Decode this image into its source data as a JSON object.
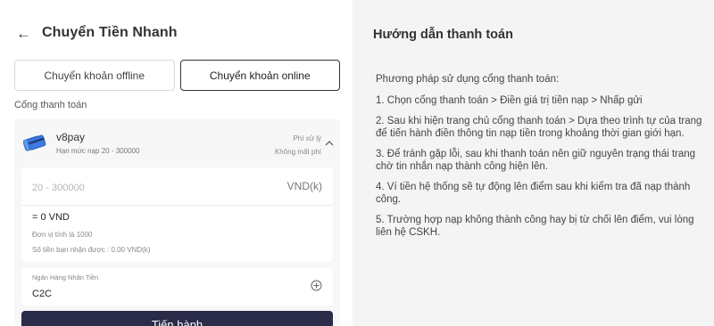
{
  "header": {
    "title": "Chuyển Tiền Nhanh",
    "back_icon": "arrow-left-icon"
  },
  "tabs": [
    {
      "label": "Chuyển khoản offline",
      "active": false
    },
    {
      "label": "Chuyển khoản online",
      "active": true
    }
  ],
  "payment_gateway": {
    "section_label": "Cổng thanh toán",
    "name": "v8pay",
    "limit": "Hạn mức nạp 20 - 300000",
    "fee_label": "Phí xử lý",
    "fee_value": "Không mất phí",
    "card_icon": "credit-card-icon",
    "amount": {
      "placeholder": "20 - 300000",
      "value": "",
      "unit": "VND(k)",
      "converted": "= 0 VND",
      "unit_note": "Đơn vị tính là 1000",
      "receive_note": "Số tiền bạn nhận được : 0.00 VND(k)"
    },
    "bank": {
      "label": "Ngân Hàng Nhận Tiền",
      "value": "C2C"
    },
    "submit_label": "Tiến hành"
  },
  "guide": {
    "title": "Hướng dẫn thanh toán",
    "intro": "Phương pháp sử dụng cổng thanh toán:",
    "steps": [
      "1. Chọn cổng thanh toán > Điền giá trị tiền nạp > Nhấp gửi",
      "2. Sau khi hiện trang chủ cổng thanh toán > Dựa theo trình tự của trang để tiến hành điền thông tin nạp tiền trong khoảng thời gian giới hạn.",
      "3. Để tránh gặp lỗi, sau khi thanh toán nên giữ nguyên trạng thái trang chờ tin nhắn nạp thành công hiện lên.",
      "4. Ví tiền hệ thống sẽ tự động lên điểm sau khi kiểm tra đã nạp thành công.",
      "5. Trường hợp nạp không thành công hay bị từ chối lên điểm, vui lòng liên hệ CSKH."
    ]
  },
  "colors": {
    "primary_button": "#2b2b4a",
    "right_panel_bg": "#f4f4f4",
    "card_icon_blue": "#3d7be0"
  }
}
